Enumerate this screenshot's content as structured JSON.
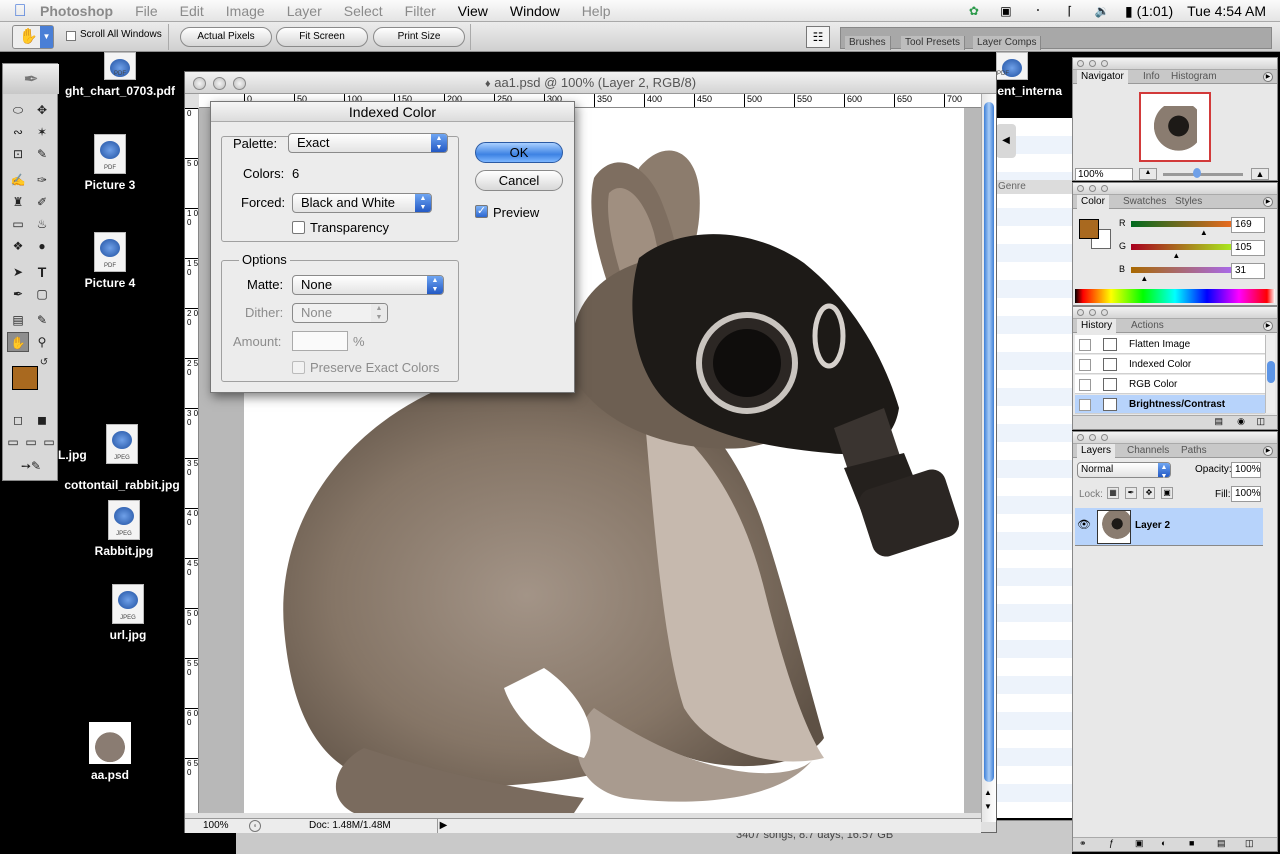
{
  "menubar": {
    "app": "Photoshop",
    "menus": [
      "File",
      "Edit",
      "Image",
      "Layer",
      "Select",
      "Filter",
      "View",
      "Window",
      "Help"
    ],
    "battery": "(1:01)",
    "clock": "Tue 4:54 AM"
  },
  "options": {
    "scroll_all": "Scroll All Windows",
    "actual_pixels": "Actual Pixels",
    "fit_screen": "Fit Screen",
    "print_size": "Print Size",
    "wells": [
      "Brushes",
      "Tool Presets",
      "Layer Comps"
    ]
  },
  "desktop": {
    "icons": [
      {
        "label": "ght_chart_0703.pdf",
        "kind": "PDF"
      },
      {
        "label": "Picture 3",
        "kind": "PDF"
      },
      {
        "label": "Picture 4",
        "kind": "PDF"
      },
      {
        "label": "L.jpg",
        "kind": ""
      },
      {
        "label": "cottontail_rabbit.jpg",
        "kind": "JPEG"
      },
      {
        "label": "Rabbit.jpg",
        "kind": "JPEG"
      },
      {
        "label": "url.jpg",
        "kind": "JPEG"
      },
      {
        "label": "aa.psd",
        "kind": ""
      },
      {
        "label": "dent_interna",
        "kind": "PDF"
      }
    ]
  },
  "document": {
    "title": "aa1.psd @ 100% (Layer 2, RGB/8)",
    "ruler_h": [
      "0",
      "50",
      "100",
      "150",
      "200",
      "250",
      "300",
      "350",
      "400",
      "450",
      "500",
      "550",
      "600",
      "650",
      "700"
    ],
    "ruler_v": [
      "0",
      "5 0",
      "1 0 0",
      "1 5 0",
      "2 0 0",
      "2 5 0",
      "3 0 0",
      "3 5 0",
      "4 0 0",
      "4 5 0",
      "5 0 0",
      "5 5 0",
      "6 0 0",
      "6 5 0"
    ],
    "zoom": "100%",
    "doc_size": "Doc: 1.48M/1.48M"
  },
  "dialog": {
    "title": "Indexed Color",
    "palette_label": "Palette:",
    "palette_value": "Exact",
    "colors_label": "Colors:",
    "colors_value": "6",
    "forced_label": "Forced:",
    "forced_value": "Black and White",
    "transparency": "Transparency",
    "options_title": "Options",
    "matte_label": "Matte:",
    "matte_value": "None",
    "dither_label": "Dither:",
    "dither_value": "None",
    "amount_label": "Amount:",
    "amount_unit": "%",
    "preserve": "Preserve Exact Colors",
    "ok": "OK",
    "cancel": "Cancel",
    "preview": "Preview"
  },
  "navigator": {
    "tabs": [
      "Navigator",
      "Info",
      "Histogram"
    ],
    "zoom": "100%"
  },
  "color": {
    "tabs": [
      "Color",
      "Swatches",
      "Styles"
    ],
    "r_label": "R",
    "r": "169",
    "g_label": "G",
    "g": "105",
    "b_label": "B",
    "b": "31",
    "r_level": 0.663,
    "g_level": 0.412,
    "b_level": 0.122,
    "foreground": "#a9691f"
  },
  "history": {
    "tabs": [
      "History",
      "Actions"
    ],
    "items": [
      "Flatten Image",
      "Indexed Color",
      "RGB Color",
      "Brightness/Contrast"
    ]
  },
  "layers": {
    "tabs": [
      "Layers",
      "Channels",
      "Paths"
    ],
    "blend": "Normal",
    "opacity_label": "Opacity:",
    "opacity": "100%",
    "lock_label": "Lock:",
    "fill_label": "Fill:",
    "fill": "100%",
    "layer_name": "Layer 2"
  },
  "background": {
    "col_header": "Genre",
    "status": "3407 songs, 8.7 days, 16.57 GB"
  }
}
